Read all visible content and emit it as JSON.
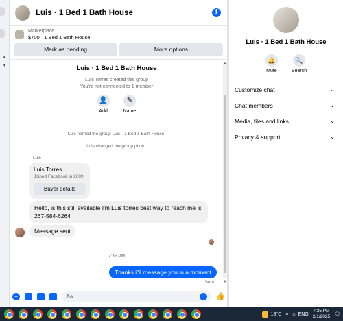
{
  "header": {
    "title": "Luis · 1 Bed 1 Bath House",
    "info_icon": "info-icon"
  },
  "marketplace": {
    "label": "Marketplace",
    "listing": "$700 · 1 Bed 1 Bath House"
  },
  "actions": {
    "pending": "Mark as pending",
    "more": "More options"
  },
  "group": {
    "title": "Luis · 1 Bed 1 Bath House",
    "created": "Luis Torres created this group",
    "connection": "You're not connected to 1 member",
    "add": "Add",
    "name": "Name"
  },
  "system": {
    "named": "Luis named the group Luis · 1 Bed 1 Bath House.",
    "photo": "Luis changed the group photo."
  },
  "messages": {
    "sender": "Luis",
    "card_name": "Luis Torres",
    "card_sub": "Joined Facebook in 2009",
    "card_button": "Buyer details",
    "msg1": "Hello, is this still available I'm Luis torres best way to reach me is 267-584-6264",
    "msg2": "Message sent",
    "time": "7:35 PM",
    "outgoing": "Thanks i\"il message you in a moment",
    "status": "Sent"
  },
  "composer": {
    "placeholder": "Aa"
  },
  "details": {
    "title": "Luis · 1 Bed 1 Bath House",
    "mute": "Mute",
    "search": "Search",
    "sections": [
      "Customize chat",
      "Chat members",
      "Media, files and links",
      "Privacy & support"
    ]
  },
  "taskbar": {
    "temperature": "18°C",
    "language": "ENG",
    "time": "7:35 PM",
    "date": "2/1/2025",
    "app_icons": [
      "chrome-icon",
      "chrome-icon",
      "chrome-icon",
      "chrome-icon",
      "chrome-icon",
      "chrome-icon",
      "chrome-icon",
      "chrome-icon",
      "chrome-icon",
      "chrome-icon",
      "chrome-icon",
      "chrome-icon",
      "chrome-icon",
      "chrome-icon"
    ]
  },
  "colors": {
    "accent": "#0866ff",
    "bubble_in": "#f0f0f0",
    "taskbar": "#1b2838"
  }
}
